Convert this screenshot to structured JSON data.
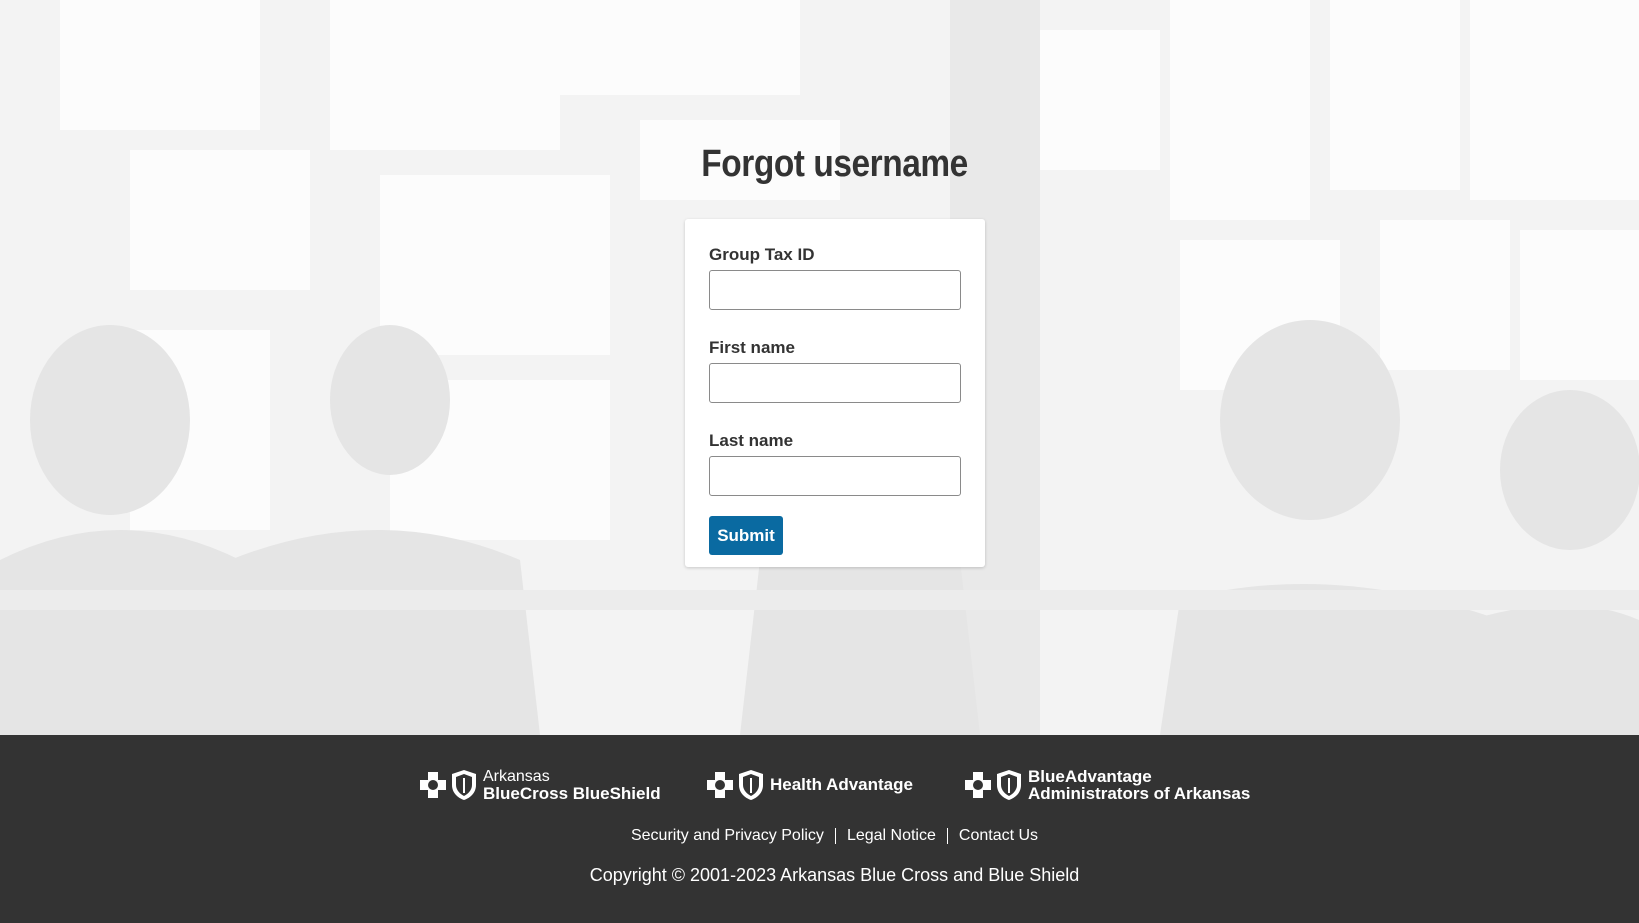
{
  "page": {
    "title": "Forgot username"
  },
  "form": {
    "fields": [
      {
        "label": "Group Tax ID",
        "value": "",
        "placeholder": ""
      },
      {
        "label": "First name",
        "value": "",
        "placeholder": ""
      },
      {
        "label": "Last name",
        "value": "",
        "placeholder": ""
      }
    ],
    "submit_label": "Submit",
    "submit_color": "#0a6aa1"
  },
  "footer": {
    "logos": [
      {
        "top_line": "Arkansas",
        "bottom_line": "BlueCross BlueShield",
        "icons": [
          "cross-icon",
          "shield-icon"
        ]
      },
      {
        "single_line": "Health Advantage",
        "icons": [
          "cross-icon",
          "shield-icon"
        ]
      },
      {
        "top_line": "BlueAdvantage",
        "bottom_line": "Administrators of Arkansas",
        "icons": [
          "cross-icon",
          "shield-icon"
        ]
      }
    ],
    "links": [
      "Security and Privacy Policy",
      "Legal Notice",
      "Contact Us"
    ],
    "copyright": "Copyright © 2001-2023 Arkansas Blue Cross and Blue Shield",
    "background_color": "#333333"
  }
}
